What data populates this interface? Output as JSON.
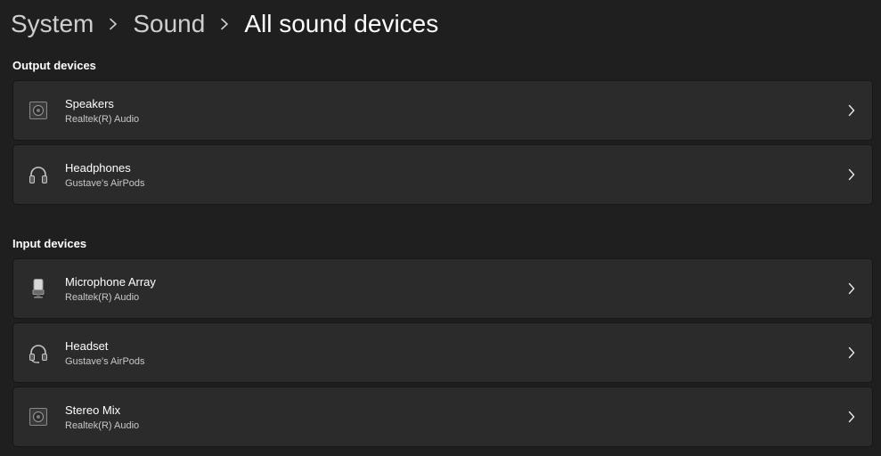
{
  "breadcrumb": {
    "items": [
      {
        "label": "System"
      },
      {
        "label": "Sound"
      },
      {
        "label": "All sound devices"
      }
    ]
  },
  "output_section": {
    "title": "Output devices",
    "devices": [
      {
        "name": "Speakers",
        "subtitle": "Realtek(R) Audio",
        "icon": "speaker-icon"
      },
      {
        "name": "Headphones",
        "subtitle": "Gustave's AirPods",
        "icon": "headphones-icon"
      }
    ]
  },
  "input_section": {
    "title": "Input devices",
    "devices": [
      {
        "name": "Microphone Array",
        "subtitle": "Realtek(R) Audio",
        "icon": "microphone-icon"
      },
      {
        "name": "Headset",
        "subtitle": "Gustave's AirPods",
        "icon": "headset-icon"
      },
      {
        "name": "Stereo Mix",
        "subtitle": "Realtek(R) Audio",
        "icon": "speaker-icon"
      }
    ]
  },
  "colors": {
    "background": "#1f1f1f",
    "card": "#2b2b2b",
    "text_primary": "#ffffff",
    "text_secondary": "#c8c8c8"
  }
}
